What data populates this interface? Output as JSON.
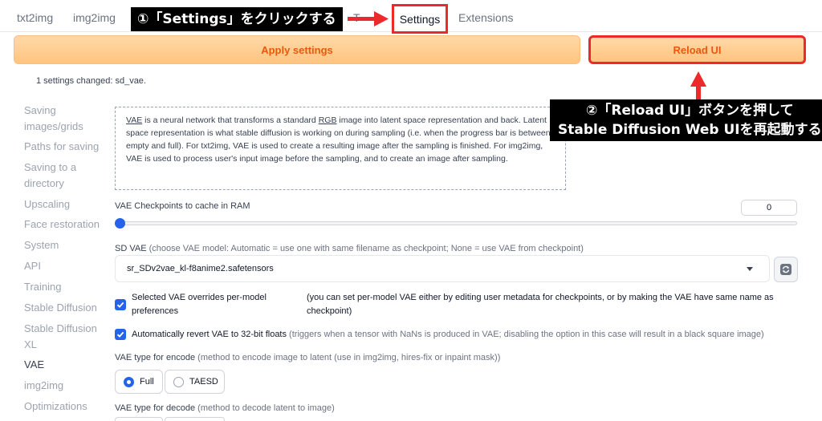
{
  "tabs": {
    "txt2img": "txt2img",
    "img2img": "img2img",
    "hidden_tab_fragment": "T",
    "settings": "Settings",
    "extensions": "Extensions"
  },
  "annotations": {
    "step1": "①「Settings」をクリックする",
    "step2_line1": "②「Reload UI」ボタンを押して",
    "step2_line2": "Stable Diffusion Web UIを再起動する",
    "accent_color": "#ec2a2a"
  },
  "buttons": {
    "apply": "Apply settings",
    "reload": "Reload UI"
  },
  "status": {
    "changed": "1 settings changed: sd_vae."
  },
  "sidebar": {
    "items": [
      "Saving images/grids",
      "Paths for saving",
      "Saving to a directory",
      "Upscaling",
      "Face restoration",
      "System",
      "API",
      "Training",
      "Stable Diffusion",
      "Stable Diffusion XL",
      "VAE",
      "img2img",
      "Optimizations"
    ],
    "active": "VAE"
  },
  "info": {
    "vae_word": "VAE",
    "part1": " is a neural network that transforms a standard ",
    "rgb_word": "RGB",
    "part2": " image into latent space representation and back. Latent space representation is what stable diffusion is working on during sampling (i.e. when the progress bar is between empty and full). For txt2img, VAE is used to create a resulting image after the sampling is finished. For img2img, VAE is used to process user's input image before the sampling, and to create an image after sampling."
  },
  "settings": {
    "cache_label": "VAE Checkpoints to cache in RAM",
    "cache_value": "0",
    "cache_slider_fraction": 0,
    "sd_vae_label": "SD VAE",
    "sd_vae_hint": " (choose VAE model: Automatic = use one with same filename as checkpoint; None = use VAE from checkpoint)",
    "sd_vae_value": "sr_SDv2vae_kl-f8anime2.safetensors",
    "override_label": "Selected VAE overrides per-model preferences",
    "override_hint": "(you can set per-model VAE either by editing user metadata for checkpoints, or by making the VAE have same name as checkpoint)",
    "override_checked": true,
    "revert_label": "Automatically revert VAE to 32-bit floats",
    "revert_hint": " (triggers when a tensor with NaNs is produced in VAE; disabling the option in this case will result in a black square image)",
    "revert_checked": true,
    "encode_label": "VAE type for encode",
    "encode_hint": " (method to encode image to latent (use in img2img, hires-fix or inpaint mask))",
    "encode_options": [
      "Full",
      "TAESD"
    ],
    "encode_selected": "Full",
    "decode_label": "VAE type for decode",
    "decode_hint": " (method to decode latent to image)"
  }
}
